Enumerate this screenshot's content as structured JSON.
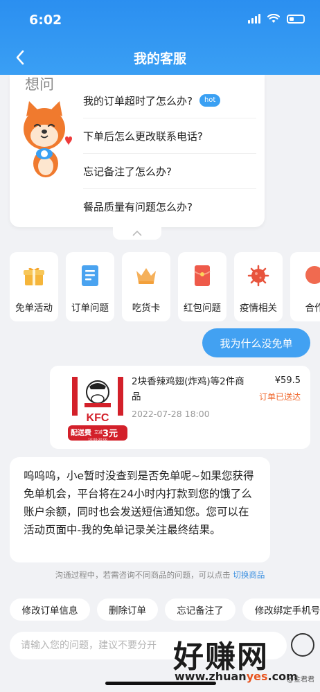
{
  "status_bar": {
    "time": "6:02"
  },
  "nav": {
    "title": "我的客服"
  },
  "faq": {
    "heading": "想问",
    "items": [
      {
        "label": "我的订单超时了怎么办?",
        "badge": "hot"
      },
      {
        "label": "下单后怎么更改联系电话?"
      },
      {
        "label": "忘记备注了怎么办?"
      },
      {
        "label": "餐品质量有问题怎么办?"
      }
    ]
  },
  "categories": [
    {
      "label": "免单活动",
      "icon": "gift-icon",
      "color": "#f5b53a"
    },
    {
      "label": "订单问题",
      "icon": "document-icon",
      "color": "#4aa3f0"
    },
    {
      "label": "吃货卡",
      "icon": "crown-icon",
      "color": "#f5b05a"
    },
    {
      "label": "红包问题",
      "icon": "red-envelope-icon",
      "color": "#ee5a4a"
    },
    {
      "label": "疫情相关",
      "icon": "virus-icon",
      "color": "#e8543d"
    },
    {
      "label": "合作",
      "icon": "chat-icon",
      "color": "#f06a50"
    }
  ],
  "chat": {
    "user_message": "我为什么没免单",
    "order": {
      "name": "2块香辣鸡翅(炸鸡)等2件商品",
      "price": "¥59.5",
      "status": "订单已送达",
      "time": "2022-07-28 18:00",
      "thumb": {
        "brand": "KFC",
        "promo": "配送费",
        "promo_note": "立减",
        "promo_amount": "3元",
        "promo_time": "10:00-20:00"
      }
    },
    "bot_message": "呜呜呜，小e暂时没查到是否免单呢~如果您获得免单机会，平台将在24小时内打款到您的饿了么账户余额，同时也会发送短信通知您。您可以在活动页面中-我的免单记录关注最终结果。",
    "hint_text": "沟通过程中，若需咨询不同商品的问题，可以点击",
    "hint_link": "切换商品"
  },
  "quick_replies": [
    "修改订单信息",
    "删除订单",
    "忘记备注了",
    "修改绑定手机号"
  ],
  "input": {
    "placeholder": "请输入您的问题，建议不要分开"
  },
  "watermark": {
    "big": "好赚网",
    "url_pre": "www.zhuan",
    "url_accent": "yes",
    "url_post": ".com",
    "small": "@金君君"
  },
  "colors": {
    "primary": "#2b8ff0",
    "user_bubble": "#42a1f2",
    "status_orange": "#f0692e",
    "link": "#3a8fe0"
  }
}
